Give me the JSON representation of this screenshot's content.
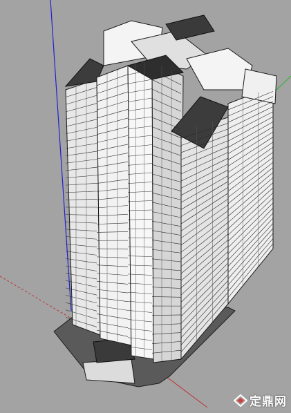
{
  "scene": {
    "background_color": "#a3a3a3",
    "axis_colors": {
      "blue": "#2020d0",
      "red": "#c03030",
      "green": "#30b030"
    },
    "building_colors": {
      "wall": "#f2f2f2",
      "shade": "#d9d9d9",
      "dark": "#4a4a4a",
      "roof": "#3c3c3c",
      "base": "#5a5a5a",
      "line": "#1a1a1a"
    }
  },
  "watermark": {
    "text": "定鼎网",
    "logo_icon": "diamond-logo-icon"
  }
}
